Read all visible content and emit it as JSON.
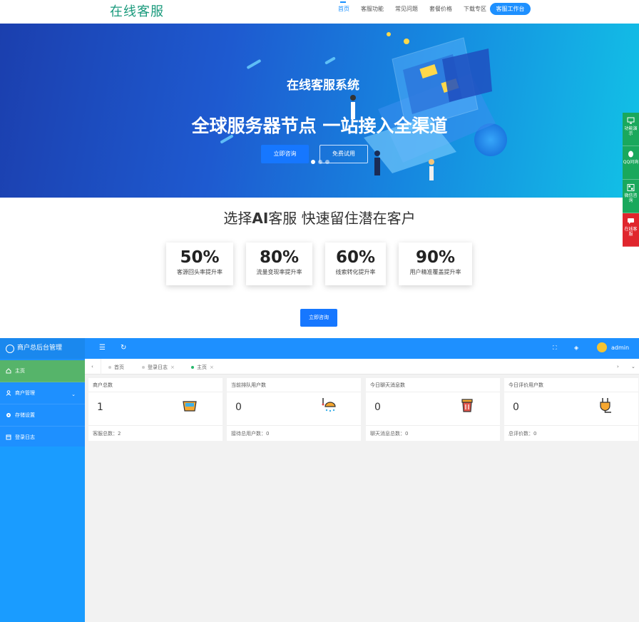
{
  "site": {
    "logo": "在线客服",
    "nav": [
      "首页",
      "客服功能",
      "常见问题",
      "套餐价格",
      "下载专区"
    ],
    "nav_cta": "客服工作台"
  },
  "hero": {
    "subtitle": "在线客服系统",
    "title": "全球服务器节点 一站接入全渠道",
    "btn_primary": "立即咨询",
    "btn_secondary": "免费试用"
  },
  "float_bar": [
    {
      "icon": "monitor-icon",
      "label": "功能演示",
      "color": "#1aa85c"
    },
    {
      "icon": "qq-icon",
      "label": "QQ问询",
      "color": "#1aa85c"
    },
    {
      "icon": "qrcode-icon",
      "label": "微信咨询",
      "color": "#1aa85c"
    },
    {
      "icon": "chat-icon",
      "label": "在线客服",
      "color": "#e0262d"
    }
  ],
  "stats": {
    "title_pre": "选择",
    "title_bold": "AI",
    "title_post": "客服 快速留住潜在客户",
    "items": [
      {
        "value": "50%",
        "label": "客源回头率提升率"
      },
      {
        "value": "80%",
        "label": "流量变现率提升率"
      },
      {
        "value": "60%",
        "label": "线索转化提升率"
      },
      {
        "value": "90%",
        "label": "用户精准覆盖提升率"
      }
    ],
    "cta": "立即咨询"
  },
  "admin": {
    "brand": "商户总后台管理",
    "menu": [
      {
        "label": "主页",
        "icon": "home-icon"
      },
      {
        "label": "商户管理",
        "icon": "user-icon"
      },
      {
        "label": "存储设置",
        "icon": "gear-icon"
      },
      {
        "label": "登录日志",
        "icon": "log-icon"
      }
    ],
    "user": "admin",
    "tabs": [
      "首页",
      "登录日志",
      "主页"
    ],
    "cards": [
      {
        "title": "商户总数",
        "value": "1",
        "footer": "客服总数：2",
        "icon": "basket-icon"
      },
      {
        "title": "当前排队用户数",
        "value": "0",
        "footer": "接待总用户数：0",
        "icon": "shower-icon"
      },
      {
        "title": "今日聊天消息数",
        "value": "0",
        "footer": "聊天消息总数：0",
        "icon": "trash-icon"
      },
      {
        "title": "今日评价用户数",
        "value": "0",
        "footer": "总评价数：0",
        "icon": "plug-icon"
      }
    ]
  },
  "colors": {
    "brand_green": "#1a9a7c",
    "primary_blue": "#1e90ff",
    "active_menu": "#56b46a",
    "float_red": "#e0262d"
  }
}
